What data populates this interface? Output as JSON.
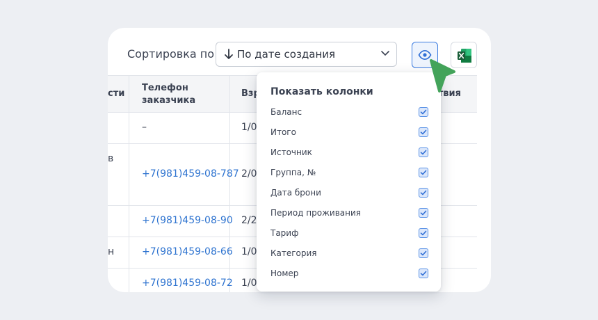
{
  "toolbar": {
    "sort_label": "Сортировка по",
    "sort_value": "По дате создания",
    "eye_icon": "eye-icon",
    "excel_icon": "excel-icon"
  },
  "table": {
    "headers": [
      "сти",
      "Телефон заказчика",
      "Взр",
      "ствия"
    ],
    "header_phone_line1": "Телефон",
    "header_phone_line2": "заказчика",
    "rows": [
      {
        "left": "",
        "phone": "–",
        "mid": "1/0"
      },
      {
        "left": "в",
        "phone": "+7(981)459-08-787",
        "mid": "2/0"
      },
      {
        "left": "",
        "phone": "+7(981)459-08-90",
        "mid": "2/2"
      },
      {
        "left": "н",
        "phone": "+7(981)459-08-66",
        "mid": "1/0"
      },
      {
        "left": "",
        "phone": "+7(981)459-08-72",
        "mid": "1/0"
      }
    ]
  },
  "columns_popup": {
    "title": "Показать колонки",
    "options": [
      {
        "label": "Баланс",
        "checked": true
      },
      {
        "label": "Итого",
        "checked": true
      },
      {
        "label": "Источник",
        "checked": true
      },
      {
        "label": "Группа, №",
        "checked": true
      },
      {
        "label": "Дата брони",
        "checked": true
      },
      {
        "label": "Период проживания",
        "checked": true
      },
      {
        "label": "Тариф",
        "checked": true
      },
      {
        "label": "Категория",
        "checked": true
      },
      {
        "label": "Номер",
        "checked": true
      }
    ]
  },
  "colors": {
    "accent": "#3a7be0",
    "link": "#2f74d0",
    "cursor": "#43a35a",
    "excel": "#1f7a45"
  }
}
